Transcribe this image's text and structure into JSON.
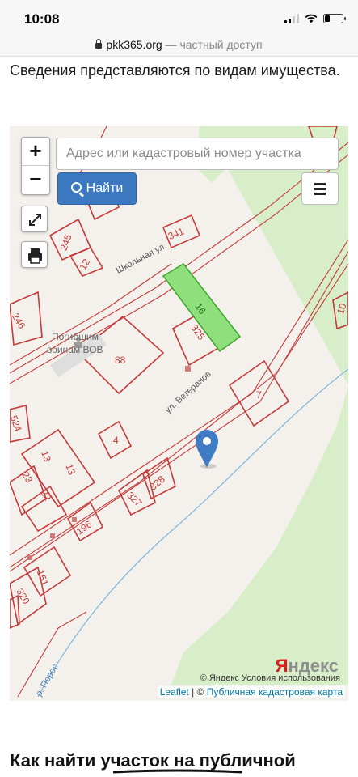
{
  "status_bar": {
    "time": "10:08",
    "battery_level": 0.3
  },
  "browser": {
    "host": "pkk365.org",
    "separator": " — ",
    "subtitle": "частный доступ"
  },
  "intro_text": "Сведения представляются по видам имущества.",
  "map": {
    "zoom_in_label": "+",
    "zoom_out_label": "−",
    "search_placeholder": "Адрес или кадастровый номер участка",
    "find_button_label": "Найти",
    "parcel_numbers": [
      "341",
      "245",
      "12",
      "16",
      "325",
      "246",
      "88",
      "7",
      "524",
      "4",
      "13",
      "13",
      "23",
      "22",
      "196",
      "327",
      "328",
      "151",
      "320",
      "10"
    ],
    "street_labels": [
      "Школьная ул.",
      "ул. Ветеранов",
      "р. Порос"
    ],
    "monument_label": [
      "Погибшим",
      "воинам ВОВ"
    ],
    "attribution": {
      "yandex_terms": "© Яндекс  Условия использования",
      "leaflet": "Leaflet",
      "divider": " | © ",
      "cadastral": "Публичная кадастровая карта"
    },
    "yandex_logo": {
      "red_letter": "Я",
      "rest": "ндекс"
    },
    "colors": {
      "parcel_border": "#c43a3a",
      "selected_parcel": "#8fe07c",
      "forest": "#d7eec9",
      "river": "#7fb5dd",
      "marker": "#3f7cc4"
    }
  },
  "section_heading": "Как найти участок на публичной"
}
